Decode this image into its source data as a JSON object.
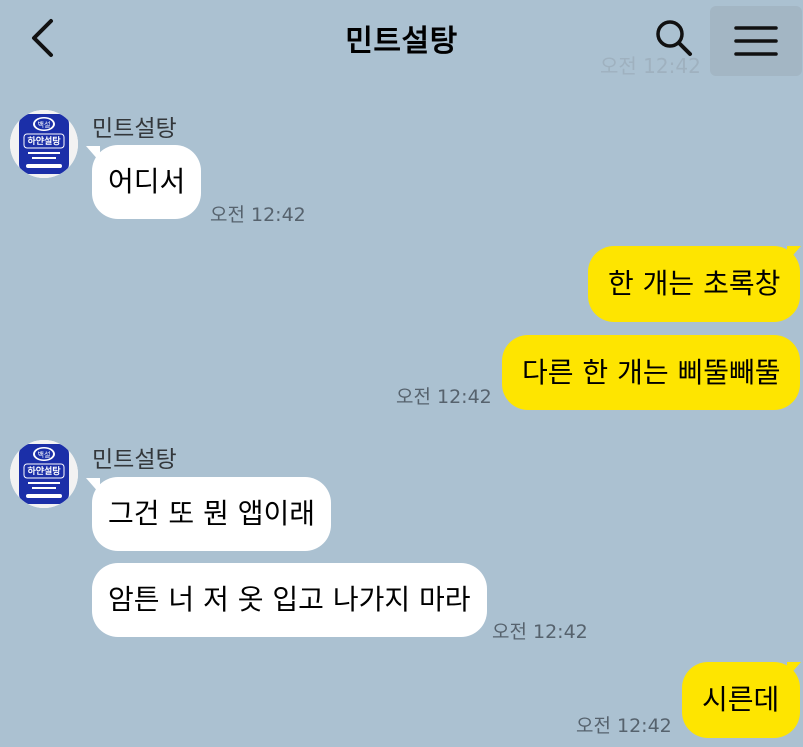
{
  "header": {
    "title": "민트설탕"
  },
  "ghost_time": "오전 12:42",
  "avatar_logo": {
    "top": "백설",
    "main": "하얀설탕",
    "bottom": "백설하얀설탕"
  },
  "messages": [
    {
      "direction": "in",
      "sender": "민트설탕",
      "text": "어디서",
      "time": "오전 12:42"
    },
    {
      "direction": "out",
      "text": "한 개는 초록창",
      "time": ""
    },
    {
      "direction": "out",
      "text": "다른 한 개는 삐뚤빼뚤",
      "time": "오전 12:42"
    },
    {
      "direction": "in",
      "sender": "민트설탕",
      "text": "그건 또 뭔 앱이래",
      "time": ""
    },
    {
      "direction": "in",
      "text": "암튼 너 저 옷 입고 나가지 마라",
      "time": "오전 12:42"
    },
    {
      "direction": "out",
      "text": "시른데",
      "time": "오전 12:42"
    }
  ],
  "colors": {
    "background": "#abc1d1",
    "outgoing_bubble": "#fee500",
    "incoming_bubble": "#ffffff"
  },
  "icons": {
    "back": "chevron-left-icon",
    "search": "search-icon",
    "menu": "hamburger-menu-icon"
  }
}
